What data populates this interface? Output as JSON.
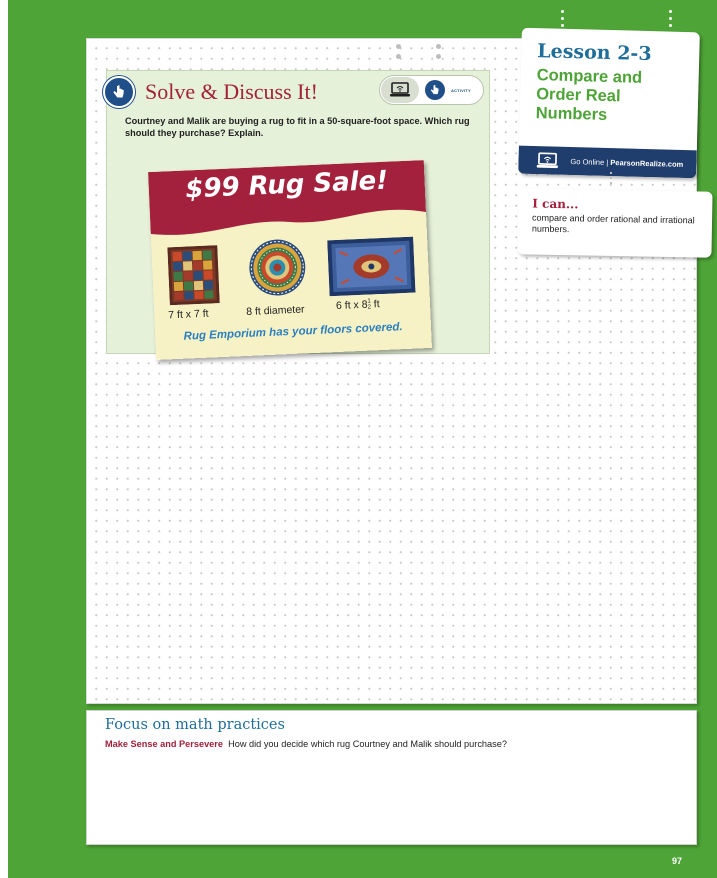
{
  "solve": {
    "title": "Solve & Discuss It!",
    "activity_label": "ACTIVITY",
    "prompt": "Courtney and Malik are buying a rug to fit in a 50-square-foot space. Which rug should they purchase? Explain."
  },
  "ad": {
    "title": "$99 Rug Sale!",
    "rugs": [
      {
        "label": "7 ft x 7 ft"
      },
      {
        "label": "8 ft diameter"
      },
      {
        "label_prefix": "6 ft x 8",
        "frac_num": "1",
        "frac_den": "2",
        "label_suffix": "ft"
      }
    ],
    "tagline": "Rug Emporium has your floors covered."
  },
  "lesson": {
    "number": "Lesson 2-3",
    "title": "Compare and Order Real Numbers",
    "online_prefix": "Go Online",
    "online_separator": "|",
    "online_site": "PearsonRealize.com"
  },
  "ican": {
    "title": "I can...",
    "text": "compare and order rational and irrational numbers."
  },
  "focus": {
    "title": "Focus on math practices",
    "lead": "Make Sense and Persevere",
    "question": "How did you decide which rug Courtney and Malik should purchase?"
  },
  "page_number": "97",
  "colors": {
    "brand_green": "#4ea436",
    "title_red": "#a3213d",
    "lesson_blue": "#1f6d99",
    "navy": "#1f3d6d",
    "tagline_blue": "#2a7fbf",
    "panel_green": "#e6f1d9"
  },
  "icons": [
    "hand-pointer-icon",
    "laptop-wifi-icon"
  ]
}
